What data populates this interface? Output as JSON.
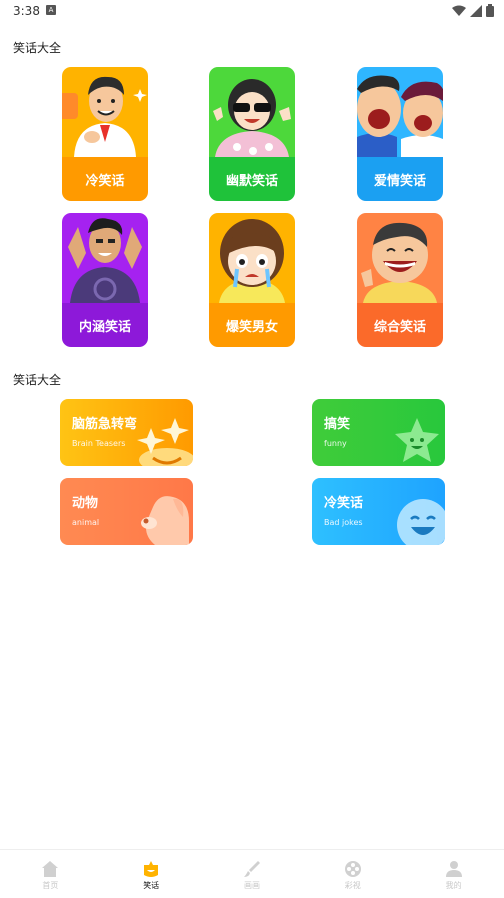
{
  "status": {
    "time": "3:38",
    "a_icon": "A"
  },
  "section1": {
    "title": "笑话大全",
    "cards": [
      {
        "label": "冷笑话",
        "band": "#ff9a00",
        "bg": "#ffb300"
      },
      {
        "label": "幽默笑话",
        "band": "#1fc23a",
        "bg": "#4dd83b"
      },
      {
        "label": "爱情笑话",
        "band": "#1ba0f2",
        "bg": "#2fb6ff"
      },
      {
        "label": "内涵笑话",
        "band": "#8d19d9",
        "bg": "#a522f0"
      },
      {
        "label": "爆笑男女",
        "band": "#ff9a00",
        "bg": "#ffb300"
      },
      {
        "label": "综合笑话",
        "band": "#fb6a2a",
        "bg": "#ff8344"
      }
    ]
  },
  "section2": {
    "title": "笑话大全",
    "cards": [
      {
        "title": "脑筋急转弯",
        "sub": "Brain Teasers",
        "from": "#ffc414",
        "to": "#ff9a00"
      },
      {
        "title": "搞笑",
        "sub": "funny",
        "from": "#40cc3a",
        "to": "#28c83c"
      },
      {
        "title": "动物",
        "sub": "animal",
        "from": "#ff8a52",
        "to": "#ff7848"
      },
      {
        "title": "冷笑话",
        "sub": "Bad jokes",
        "from": "#2ec0ff",
        "to": "#1ea3ff"
      }
    ]
  },
  "nav": [
    {
      "label": "首页",
      "icon": "home-icon"
    },
    {
      "label": "笑话",
      "icon": "joke-icon",
      "active": true
    },
    {
      "label": "画画",
      "icon": "brush-icon"
    },
    {
      "label": "彩视",
      "icon": "film-reel-icon"
    },
    {
      "label": "我的",
      "icon": "person-icon"
    }
  ]
}
